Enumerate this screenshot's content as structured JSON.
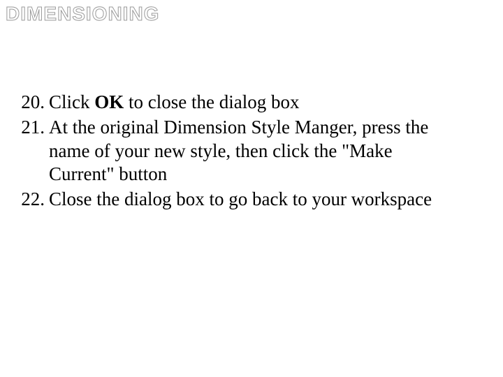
{
  "title": "DIMENSIONING",
  "list": {
    "start": 20,
    "items": [
      {
        "num": "20.",
        "pre": "Click ",
        "bold": "OK",
        "post": " to close the dialog box"
      },
      {
        "num": "21.",
        "text": "At the original Dimension Style Manger, press  the name of your new style, then click the  \"Make Current\" button"
      },
      {
        "num": "22.",
        "text": "Close the dialog box to go back to your  workspace"
      }
    ]
  }
}
